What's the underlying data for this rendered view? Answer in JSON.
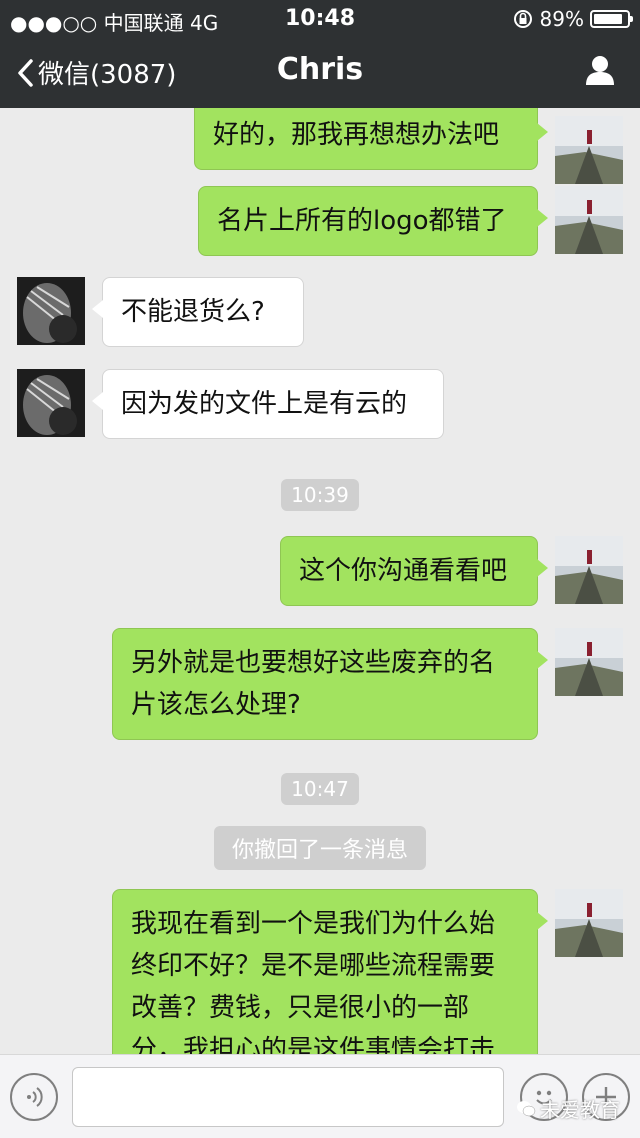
{
  "status": {
    "carrier": "●●●○○ 中国联通  4G",
    "time": "10:48",
    "battery": "89%",
    "battery_level": 0.89
  },
  "nav": {
    "back_label": "微信(3087)",
    "title": "Chris"
  },
  "messages": [
    {
      "from": "me",
      "text": "好的，那我再想想办法吧"
    },
    {
      "from": "me",
      "text": "名片上所有的logo都错了"
    },
    {
      "from": "other",
      "text": "不能退货么?"
    },
    {
      "from": "other",
      "text": "因为发的文件上是有云的"
    },
    {
      "timestamp": "10:39"
    },
    {
      "from": "me",
      "text": "这个你沟通看看吧"
    },
    {
      "from": "me",
      "text": "另外就是也要想好这些废弃的名片该怎么处理?"
    },
    {
      "timestamp": "10:47"
    },
    {
      "system": "你撤回了一条消息"
    },
    {
      "from": "me",
      "text": "我现在看到一个是我们为什么始终印不好？是不是哪些流程需要改善？费钱，只是很小的一部分，我担心的是这件事情会打击到大家的信心，以及我们看何效"
    }
  ],
  "input": {
    "placeholder": "",
    "voice_icon": "voice-icon",
    "emoji_icon": "emoji-icon",
    "plus_icon": "plus-icon"
  },
  "watermark": "未爱教育"
}
